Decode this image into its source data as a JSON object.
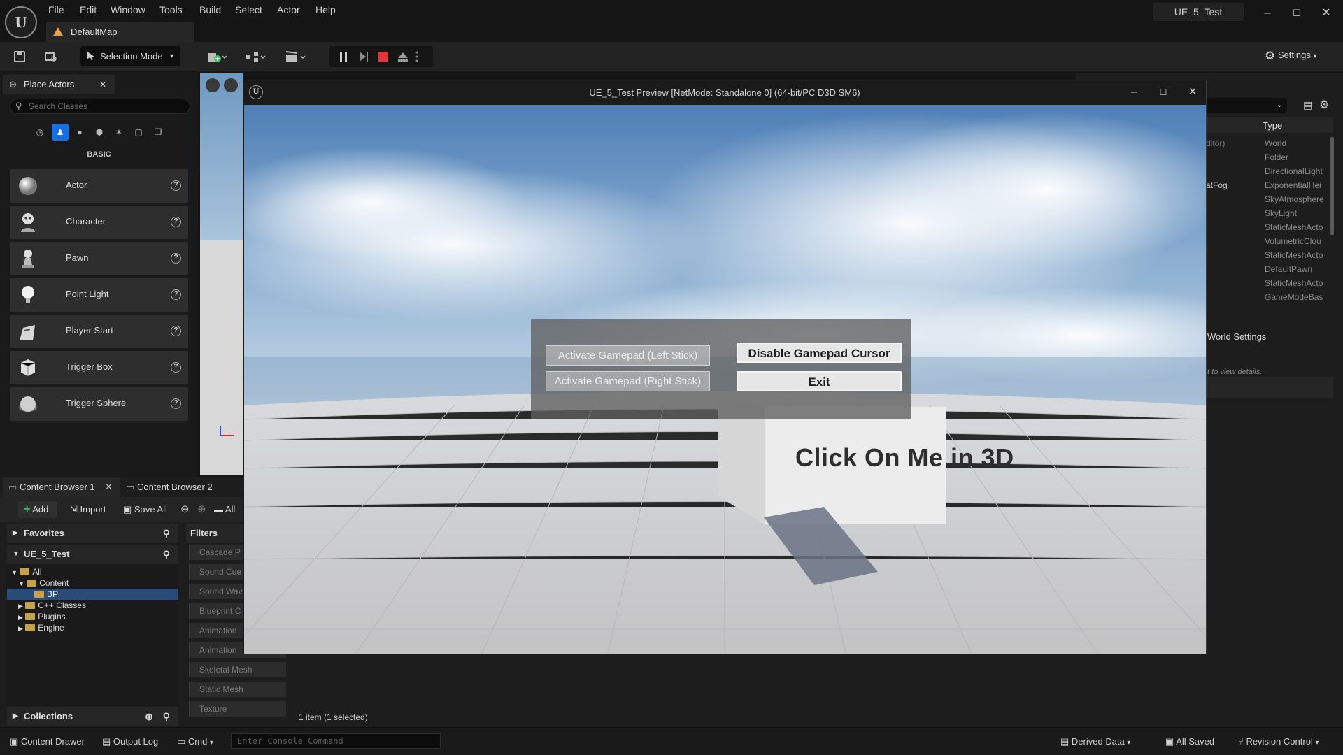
{
  "window": {
    "project_name": "UE_5_Test",
    "map_tab": "DefaultMap",
    "controls": {
      "minimize": "–",
      "maximize": "☐",
      "close": "✕"
    }
  },
  "menu": [
    "File",
    "Edit",
    "Window",
    "Tools",
    "Build",
    "Select",
    "Actor",
    "Help"
  ],
  "toolbar": {
    "selection_mode": "Selection Mode",
    "settings": "Settings"
  },
  "place_actors": {
    "tab": "Place Actors",
    "search_placeholder": "Search Classes",
    "category": "BASIC",
    "items": [
      {
        "label": "Actor",
        "icon": "sphere-icon"
      },
      {
        "label": "Character",
        "icon": "character-icon"
      },
      {
        "label": "Pawn",
        "icon": "pawn-icon"
      },
      {
        "label": "Point Light",
        "icon": "bulb-icon"
      },
      {
        "label": "Player Start",
        "icon": "player-start-icon"
      },
      {
        "label": "Trigger Box",
        "icon": "trigger-box-icon"
      },
      {
        "label": "Trigger Sphere",
        "icon": "trigger-sphere-icon"
      }
    ]
  },
  "content_browser": {
    "tabs": [
      "Content Browser 1",
      "Content Browser 2"
    ],
    "add": "Add",
    "import": "Import",
    "save_all": "Save All",
    "path_root": "All",
    "favorites": "Favorites",
    "project": "UE_5_Test",
    "tree": [
      "All",
      "Content",
      "BP",
      "C++ Classes",
      "Plugins",
      "Engine"
    ],
    "collections": "Collections",
    "filters_title": "Filters",
    "filters": [
      "Cascade P",
      "Sound Cue",
      "Sound Wav",
      "Blueprint C",
      "Animation",
      "Animation",
      "Skeletal Mesh",
      "Static Mesh",
      "Texture"
    ],
    "item_count": "1 item (1 selected)"
  },
  "outliner": {
    "type_header": "Type",
    "partial_labels": [
      "ditor)",
      "atFog"
    ],
    "types": [
      "World",
      "Folder",
      "DirectionalLight",
      "ExponentialHei",
      "SkyAtmosphere",
      "SkyLight",
      "StaticMeshActo",
      "VolumetricClou",
      "StaticMeshActo",
      "DefaultPawn",
      "StaticMeshActo",
      "GameModeBas"
    ],
    "world_settings": "World Settings",
    "view_details": "t to view details."
  },
  "status_bar": {
    "content_drawer": "Content Drawer",
    "output_log": "Output Log",
    "cmd": "Cmd",
    "console_placeholder": "Enter Console Command",
    "derived_data": "Derived Data",
    "all_saved": "All Saved",
    "revision_control": "Revision Control"
  },
  "preview": {
    "title": "UE_5_Test Preview [NetMode: Standalone 0]  (64-bit/PC D3D SM6)",
    "buttons": {
      "left_stick": "Activate Gamepad (Left Stick)",
      "right_stick": "Activate Gamepad (Right Stick)",
      "disable_cursor": "Disable Gamepad Cursor",
      "exit": "Exit"
    },
    "world_text": "Click On Me in 3D"
  }
}
